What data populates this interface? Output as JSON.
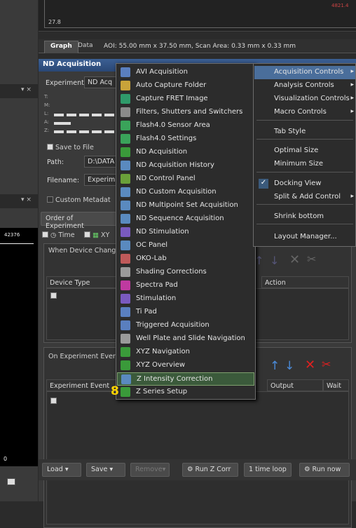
{
  "plot": {
    "y_label": "27.8",
    "top_right_value": "4821.4",
    "mid_value": "42376"
  },
  "tabs": [
    {
      "label": "Graph"
    },
    {
      "label": "Data"
    }
  ],
  "info_line": "AOI: 55.00 mm x 37.50 mm, Scan Area: 0.33 mm x 0.33 mm",
  "panel": {
    "title": "ND Acquisition",
    "experiment_label": "Experiment:",
    "experiment_value": "ND Acq",
    "save_to_file": "Save to File",
    "path_label": "Path:",
    "path_value": "D:\\DATA",
    "filename_label": "Filename:",
    "filename_value": "Experim",
    "custom_metadata": "Custom Metadat",
    "order_label": "Order of Experiment",
    "time_label": "Time",
    "xy_label": "XY",
    "when_device": "When Device Chang",
    "device_type": "Device Type",
    "action": "Action",
    "on_experiment": "On Experiment Ever",
    "experiment_event": "Experiment Event",
    "output": "Output",
    "wait": "Wait"
  },
  "side_letters": [
    "T:",
    "M:",
    "L:",
    "A:",
    "Z:"
  ],
  "menu": {
    "items": [
      {
        "label": "AVI Acquisition",
        "color": "#5a7fbf"
      },
      {
        "label": "Auto Capture Folder",
        "color": "#c9a33a"
      },
      {
        "label": "Capture FRET Image",
        "color": "#2f9a6a"
      },
      {
        "label": "Filters, Shutters and Switchers",
        "color": "#8a8a8a"
      },
      {
        "label": "Flash4.0 Sensor Area",
        "color": "#3aa35a"
      },
      {
        "label": "Flash4.0 Settings",
        "color": "#3aa35a"
      },
      {
        "label": "ND Acquisition",
        "color": "#3a9a3a"
      },
      {
        "label": "ND Acquisition History",
        "color": "#5a8abf"
      },
      {
        "label": "ND Control Panel",
        "color": "#6aa03a"
      },
      {
        "label": "ND Custom Acquisition",
        "color": "#5a8abf"
      },
      {
        "label": "ND Multipoint Set Acquisition",
        "color": "#5a8abf"
      },
      {
        "label": "ND Sequence Acquisition",
        "color": "#5a8abf"
      },
      {
        "label": "ND Stimulation",
        "color": "#7a5abf"
      },
      {
        "label": "OC Panel",
        "color": "#5a8abf"
      },
      {
        "label": "OKO-Lab",
        "color": "#bf5a5a"
      },
      {
        "label": "Shading Corrections",
        "color": "#9a9a9a"
      },
      {
        "label": "Spectra Pad",
        "color": "#bf3aa0"
      },
      {
        "label": "Stimulation",
        "color": "#7a5abf"
      },
      {
        "label": "Ti Pad",
        "color": "#5a7fbf"
      },
      {
        "label": "Triggered Acquisition",
        "color": "#5a7fbf"
      },
      {
        "label": "Well Plate and Slide Navigation",
        "color": "#9a9a9a"
      },
      {
        "label": "XYZ Navigation",
        "color": "#3a9a3a"
      },
      {
        "label": "XYZ Overview",
        "color": "#3a9a3a"
      },
      {
        "label": "Z Intensity Correction",
        "color": "#5a8abf"
      },
      {
        "label": "Z Series Setup",
        "color": "#3a9a3a"
      }
    ],
    "highlighted_index": 23
  },
  "submenu": {
    "items": [
      {
        "label": "Acquisition Controls",
        "arrow": "▸",
        "check": ""
      },
      {
        "label": "Analysis Controls",
        "arrow": "▸",
        "check": ""
      },
      {
        "label": "Visualization Controls",
        "arrow": "▸",
        "check": ""
      },
      {
        "label": "Macro Controls",
        "arrow": "▸",
        "check": ""
      },
      {
        "label": "Tab Style",
        "arrow": "",
        "check": ""
      },
      {
        "label": "Optimal Size",
        "arrow": "",
        "check": ""
      },
      {
        "label": "Minimum Size",
        "arrow": "",
        "check": ""
      },
      {
        "label": "Docking View",
        "arrow": "",
        "check": "✓"
      },
      {
        "label": "Split & Add Control",
        "arrow": "▸",
        "check": ""
      },
      {
        "label": "Shrink bottom",
        "arrow": "",
        "check": ""
      },
      {
        "label": "Layout Manager...",
        "arrow": "",
        "check": ""
      }
    ]
  },
  "step_number": "8",
  "bottom": {
    "load": "Load",
    "save": "Save",
    "remove": "Remove",
    "run_z_corr": "Run Z Corr",
    "loop": "1 time loop",
    "run_now": "Run now"
  },
  "left_zero": "0"
}
